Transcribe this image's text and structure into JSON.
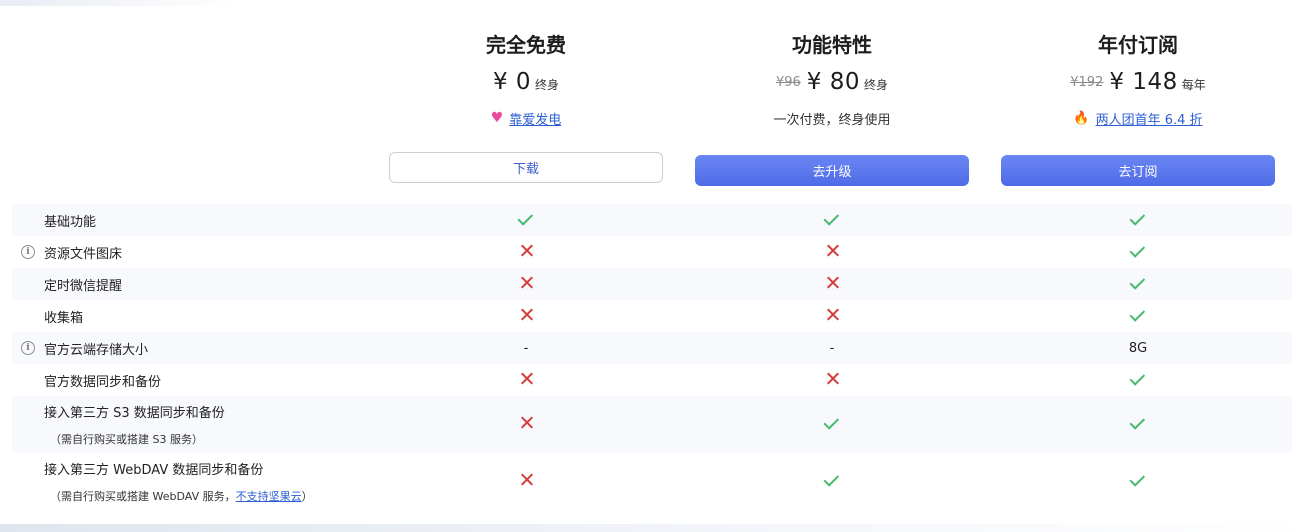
{
  "plans": [
    {
      "name": "完全免费",
      "currency": "¥",
      "price": "0",
      "original_price": "",
      "period": "终身",
      "note_icon": "heart-icon",
      "note_text": "靠爱发电",
      "button_label": "下载"
    },
    {
      "name": "功能特性",
      "currency": "¥",
      "price": "80",
      "original_price": "¥96",
      "period": "终身",
      "note_text": "一次付费，终身使用",
      "button_label": "去升级"
    },
    {
      "name": "年付订阅",
      "currency": "¥",
      "price": "148",
      "original_price": "¥192",
      "period": "每年",
      "note_icon": "fire-icon",
      "note_text": "两人团首年 6.4 折",
      "button_label": "去订阅"
    }
  ],
  "features": [
    {
      "label": "基础功能",
      "info": false,
      "values": [
        "check",
        "check",
        "check"
      ]
    },
    {
      "label": "资源文件图床",
      "info": true,
      "values": [
        "cross",
        "cross",
        "check"
      ]
    },
    {
      "label": "定时微信提醒",
      "info": false,
      "values": [
        "cross",
        "cross",
        "check"
      ]
    },
    {
      "label": "收集箱",
      "info": false,
      "values": [
        "cross",
        "cross",
        "check"
      ]
    },
    {
      "label": "官方云端存储大小",
      "info": true,
      "values": [
        "-",
        "-",
        "8G"
      ]
    },
    {
      "label": "官方数据同步和备份",
      "info": false,
      "values": [
        "cross",
        "cross",
        "check"
      ]
    },
    {
      "label": "接入第三方 S3 数据同步和备份",
      "sublabel": "（需自行购买或搭建 S3 服务）",
      "info": false,
      "values": [
        "cross",
        "check",
        "check"
      ]
    },
    {
      "label": "接入第三方 WebDAV 数据同步和备份",
      "sublabel": "（需自行购买或搭建 WebDAV 服务，",
      "sublink": "不支持坚果云",
      "sublabel_end": "）",
      "info": false,
      "values": [
        "cross",
        "check",
        "check"
      ]
    }
  ],
  "colors": {
    "check": "#47b86c",
    "cross": "#d43c3c",
    "primary": "#5874ec",
    "link": "#2d5fd4",
    "heart": "#e84a9c"
  }
}
